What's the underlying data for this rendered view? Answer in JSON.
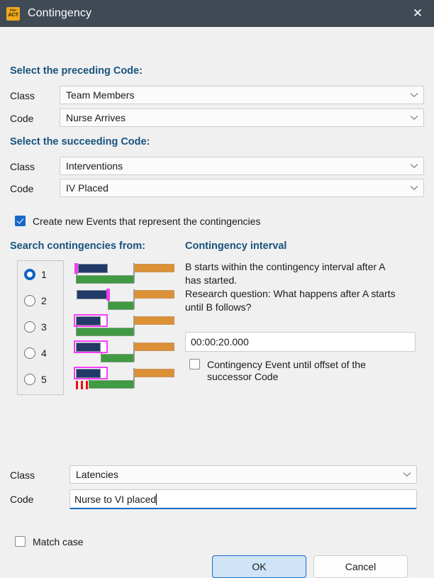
{
  "window": {
    "title": "Contingency",
    "icon_name": "interact-app-icon",
    "icon_top_text": "Inter",
    "icon_bottom_text": "ACT",
    "close_label": "✕",
    "titlebar_color": "#3f4a54"
  },
  "colors": {
    "heading": "#16537e",
    "accent": "#1668c8",
    "navy_bar": "#233a68",
    "green_bar": "#3f9a42",
    "orange_bar": "#dc9136",
    "marker_magenta": "#f53ff5",
    "tick_red": "#f01010",
    "dialog_bg": "#f0f0f0"
  },
  "preceding": {
    "heading": "Select the preceding Code:",
    "class_label": "Class",
    "class_value": "Team Members",
    "code_label": "Code",
    "code_value": "Nurse Arrives"
  },
  "succeeding": {
    "heading": "Select the succeeding Code:",
    "class_label": "Class",
    "class_value": "Interventions",
    "code_label": "Code",
    "code_value": "IV Placed"
  },
  "create_events": {
    "label": "Create new Events that represent the contingencies",
    "checked": true
  },
  "search_from": {
    "heading": "Search contingencies from:",
    "selected": "1",
    "options": [
      "1",
      "2",
      "3",
      "4",
      "5"
    ]
  },
  "contingency_interval": {
    "heading": "Contingency interval",
    "description_line1": "B starts within the contingency interval after A",
    "description_line2": "has started.",
    "description_line3": "Research question: What happens after A starts",
    "description_line4": "until B follows?",
    "interval_value": "00:00:20.000",
    "until_offset_label_line1": "Contingency Event until offset of the",
    "until_offset_label_line2": "successor Code",
    "until_offset_checked": false
  },
  "result": {
    "class_label": "Class",
    "class_value": "Latencies",
    "code_label": "Code",
    "code_value": "Nurse to VI placed"
  },
  "match_case": {
    "label": "Match case",
    "checked": false
  },
  "buttons": {
    "ok": "OK",
    "cancel": "Cancel"
  }
}
